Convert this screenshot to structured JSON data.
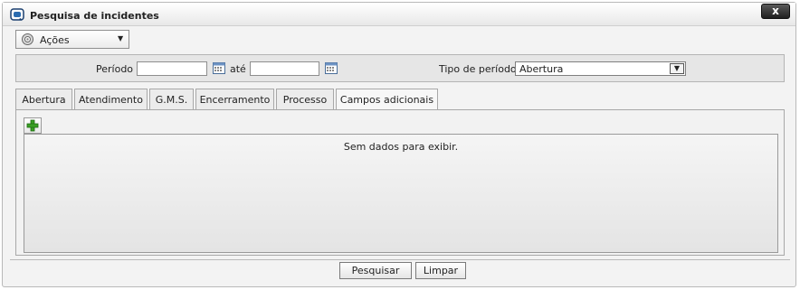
{
  "window": {
    "title": "Pesquisa de incidentes",
    "close_label": "x"
  },
  "actions": {
    "label": "Ações"
  },
  "filters": {
    "period_label": "Período :",
    "until_label": "até",
    "period_start_value": "",
    "period_end_value": "",
    "period_type_label": "Tipo de período :",
    "period_type_value": "Abertura"
  },
  "tabs": [
    {
      "label": "Abertura"
    },
    {
      "label": "Atendimento"
    },
    {
      "label": "G.M.S."
    },
    {
      "label": "Encerramento"
    },
    {
      "label": "Processo"
    },
    {
      "label": "Campos adicionais"
    }
  ],
  "grid": {
    "empty_message": "Sem dados para exibir."
  },
  "buttons": {
    "search_label": "Pesquisar",
    "clear_label": "Limpar"
  },
  "colors": {
    "add_icon": "#3aa024",
    "app_icon": "#2b6cb0"
  }
}
